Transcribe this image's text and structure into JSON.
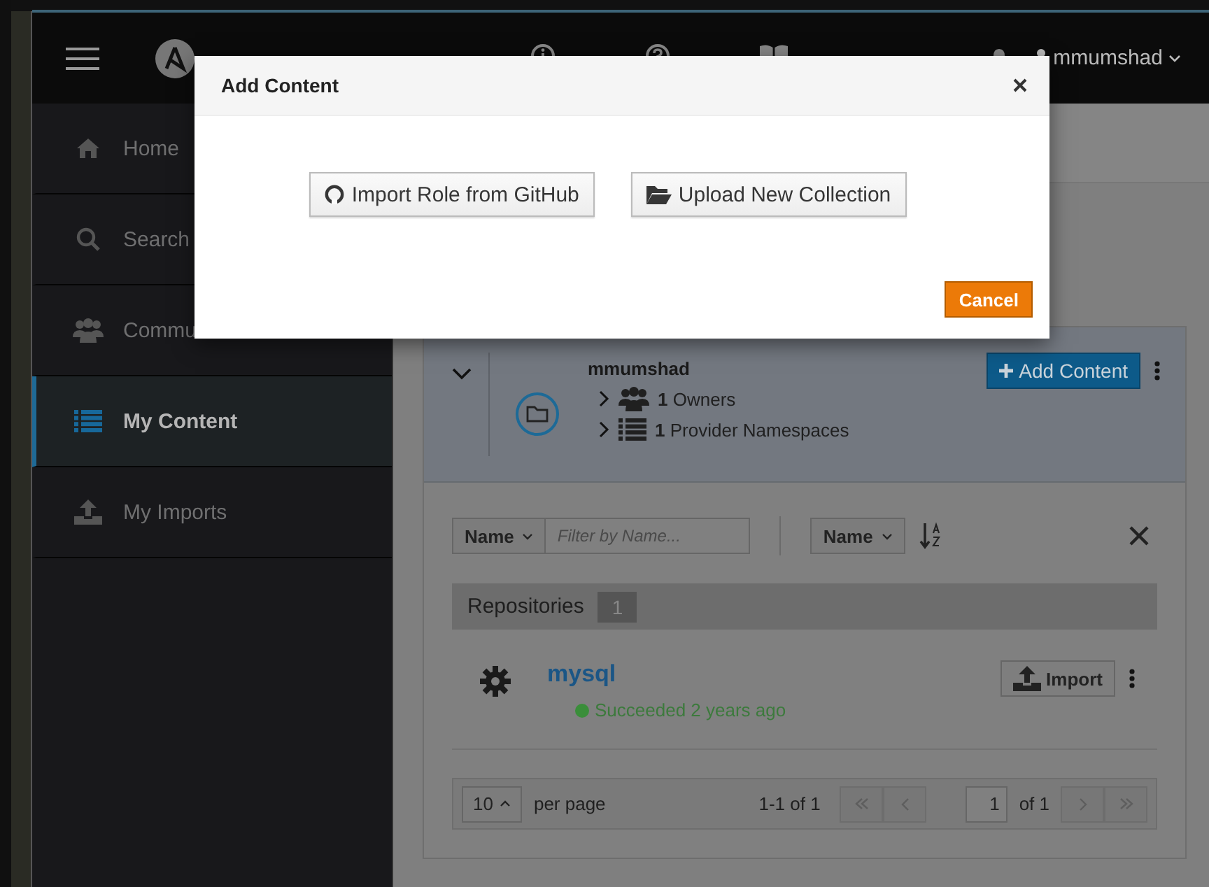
{
  "top_bar": {
    "user": "mmumshad"
  },
  "sidebar": {
    "items": [
      {
        "label": "Home",
        "selected": false
      },
      {
        "label": "Search",
        "selected": false
      },
      {
        "label": "Commu",
        "selected": false
      },
      {
        "label": "My Content",
        "selected": true
      },
      {
        "label": "My Imports",
        "selected": false
      }
    ]
  },
  "namespace": {
    "expanded": true,
    "name": "mmumshad",
    "add_button": "Add Content",
    "owners": {
      "count": "1",
      "label": "Owners"
    },
    "providers": {
      "count": "1",
      "label": "Provider Namespaces"
    }
  },
  "filter": {
    "field": "Name",
    "placeholder": "Filter by Name...",
    "sort_field": "Name"
  },
  "repositories": {
    "label": "Repositories",
    "count": "1",
    "items": [
      {
        "name": "mysql",
        "status": "Succeeded 2 years ago",
        "color": "#3a8e3a",
        "button": "Import"
      }
    ]
  },
  "pagination": {
    "per_page": "10",
    "per_page_label": "per page",
    "range": "1-1 of 1",
    "page": "1",
    "page_total": "of 1"
  },
  "modal": {
    "title": "Add Content",
    "buttons": [
      "Import Role from GitHub",
      "Upload New Collection"
    ],
    "cancel": "Cancel"
  }
}
